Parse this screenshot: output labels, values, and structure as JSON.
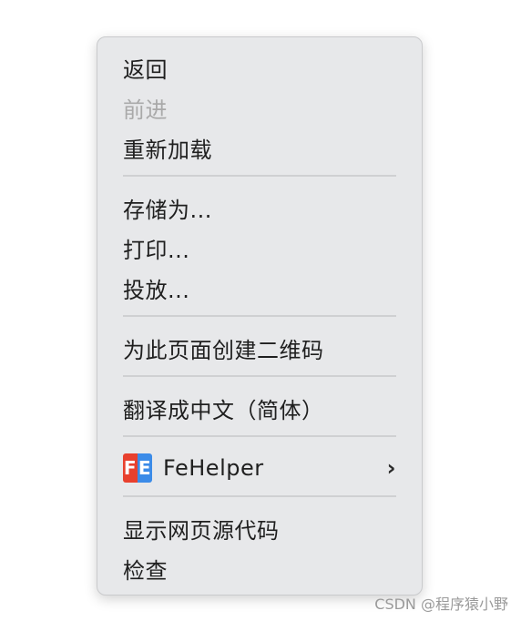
{
  "menu": {
    "items": [
      {
        "label": "返回",
        "disabled": false
      },
      {
        "label": "前进",
        "disabled": true
      },
      {
        "label": "重新加载",
        "disabled": false
      },
      {
        "label": "存储为...",
        "disabled": false
      },
      {
        "label": "打印...",
        "disabled": false
      },
      {
        "label": "投放...",
        "disabled": false
      },
      {
        "label": "为此页面创建二维码",
        "disabled": false
      },
      {
        "label": "翻译成中文（简体）",
        "disabled": false
      },
      {
        "label": "FeHelper",
        "disabled": false,
        "icon": "fehelper-logo-icon",
        "submenu_icon": "chevron-right-icon",
        "logo_letters": [
          "F",
          "E"
        ]
      },
      {
        "label": "显示网页源代码",
        "disabled": false
      },
      {
        "label": "检查",
        "disabled": false
      }
    ],
    "submenu_chevron": "›",
    "colors": {
      "background": "#e7e8ea",
      "text": "#1f1f1f",
      "disabled_text": "#a9a9a9",
      "logo_red": "#e8402e",
      "logo_blue": "#3b8be8"
    }
  },
  "watermark": "CSDN @程序猿小野"
}
